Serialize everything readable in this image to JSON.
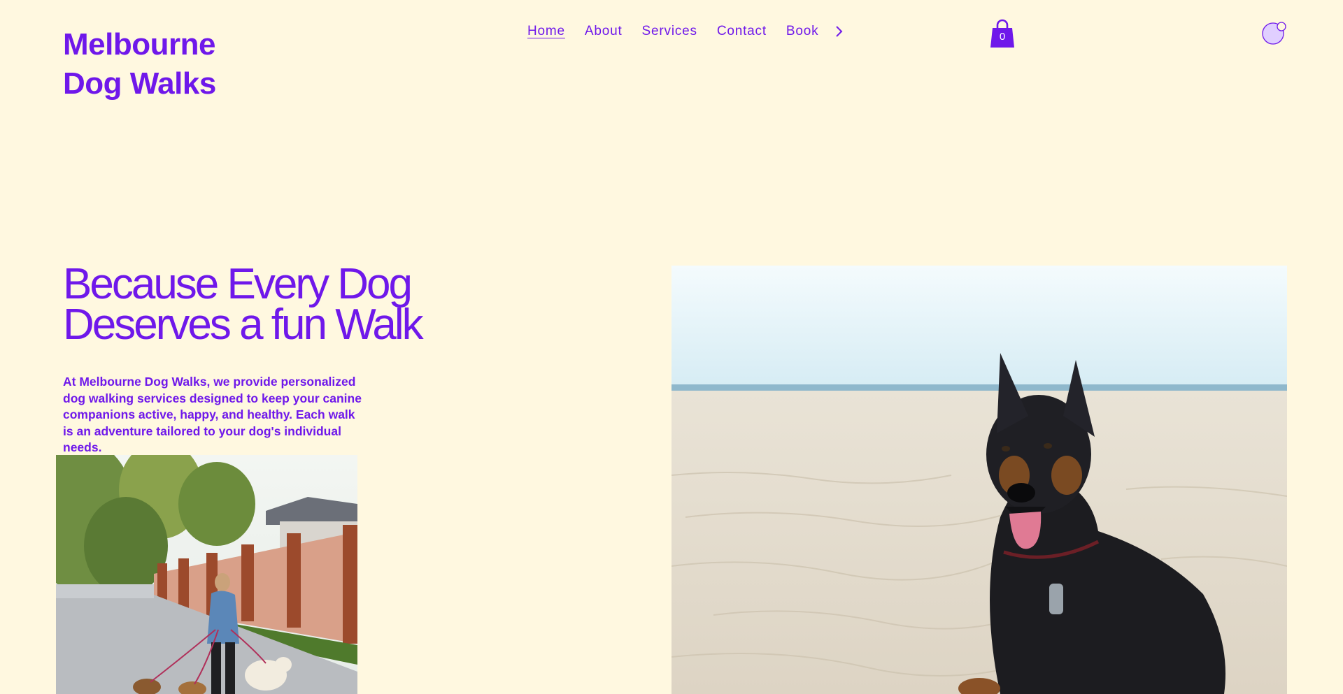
{
  "brand": {
    "line1": "Melbourne",
    "line2": "Dog Walks",
    "accent_color": "#6f18ea",
    "background_color": "#fff8e0"
  },
  "nav": {
    "items": [
      {
        "label": "Home",
        "active": true
      },
      {
        "label": "About"
      },
      {
        "label": "Services"
      },
      {
        "label": "Contact"
      },
      {
        "label": "Book"
      }
    ],
    "more_icon": "chevron-right-icon"
  },
  "cart": {
    "icon": "shopping-bag-icon",
    "count": "0"
  },
  "account": {
    "icon": "avatar-icon"
  },
  "hero": {
    "title_line1": "Because Every Dog",
    "title_line2": "Deserves a fun Walk",
    "description": "At Melbourne Dog Walks, we provide personalized dog walking services designed to keep your canine companions active, happy, and healthy. Each walk is an adventure tailored to your dog's individual needs."
  }
}
